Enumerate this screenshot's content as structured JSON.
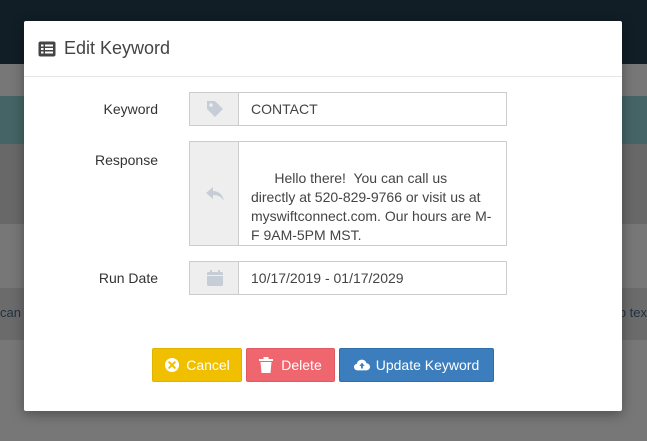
{
  "background": {
    "left_fragment": "can t",
    "right_fragment": "o tex"
  },
  "modal": {
    "title": "Edit Keyword",
    "title_icon": "list-icon"
  },
  "form": {
    "keyword": {
      "label": "Keyword",
      "icon": "tag-icon",
      "value": "CONTACT"
    },
    "response": {
      "label": "Response",
      "icon": "reply-icon",
      "value": "Hello there!  You can call us directly at 520-829-9766 or visit us at myswiftconnect.com. Our hours are M-F 9AM-5PM MST."
    },
    "run_date": {
      "label": "Run Date",
      "icon": "calendar-icon",
      "value": "10/17/2019 - 01/17/2029"
    }
  },
  "buttons": {
    "cancel": {
      "label": "Cancel",
      "icon": "times-circle-icon"
    },
    "delete": {
      "label": "Delete",
      "icon": "trash-icon"
    },
    "update": {
      "label": "Update Keyword",
      "icon": "cloud-upload-icon"
    }
  },
  "colors": {
    "cancel": "#f0c000",
    "delete": "#f0666f",
    "update": "#3b7dbd",
    "addon_bg": "#eeeeee",
    "icon_muted": "#c7cdd6"
  }
}
